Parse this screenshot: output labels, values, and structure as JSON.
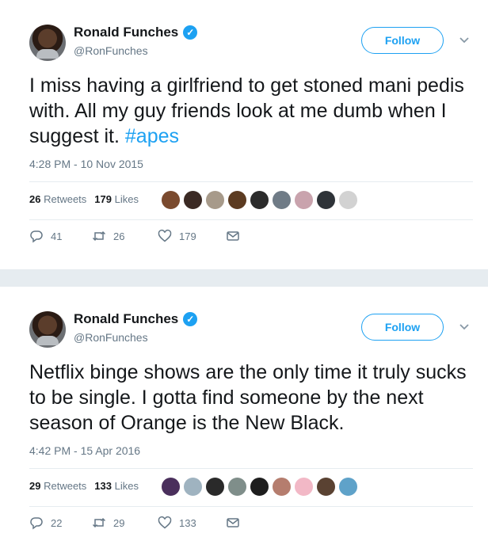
{
  "tweets": [
    {
      "name": "Ronald Funches",
      "handle": "@RonFunches",
      "follow_label": "Follow",
      "text": "I miss having a girlfriend to get stoned mani pedis with. All my guy friends look at me dumb when I suggest it. ",
      "hashtag": "#apes",
      "timestamp": "4:28 PM - 10 Nov 2015",
      "retweets_count": "26",
      "retweets_label": "Retweets",
      "likes_count": "179",
      "likes_label": "Likes",
      "replies": "41",
      "retweets_action": "26",
      "likes_action": "179",
      "liker_colors": [
        "#7a4a2e",
        "#3b2a24",
        "#a79a8a",
        "#5c3b21",
        "#2b2b2b",
        "#6f7b86",
        "#c9a3ad",
        "#2e3338",
        "#d2d2d2"
      ]
    },
    {
      "name": "Ronald Funches",
      "handle": "@RonFunches",
      "follow_label": "Follow",
      "text": "Netflix binge shows are the only time it truly sucks to be single. I gotta find someone by the next season of Orange is the New Black.",
      "hashtag": "",
      "timestamp": "4:42 PM - 15 Apr 2016",
      "retweets_count": "29",
      "retweets_label": "Retweets",
      "likes_count": "133",
      "likes_label": "Likes",
      "replies": "22",
      "retweets_action": "29",
      "likes_action": "133",
      "liker_colors": [
        "#4a2f5c",
        "#9fb3c0",
        "#2a2a2a",
        "#7f8e8a",
        "#1e1e1e",
        "#b57d6e",
        "#f2b8c6",
        "#5a4232",
        "#5fa2c9"
      ]
    }
  ],
  "icons": {
    "verified": "verified-badge-icon",
    "caret": "chevron-down-icon",
    "reply": "reply-icon",
    "retweet": "retweet-icon",
    "like": "heart-icon",
    "dm": "envelope-icon"
  },
  "colors": {
    "accent": "#1da1f2",
    "text": "#14171a",
    "muted": "#657786",
    "separator": "#e6ecf0"
  }
}
